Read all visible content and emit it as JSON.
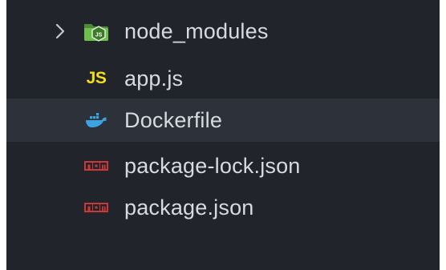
{
  "explorer": {
    "items": [
      {
        "label": "node_modules",
        "icon": "node-folder-icon",
        "expandable": true,
        "expanded": false,
        "selected": false
      },
      {
        "label": "app.js",
        "icon": "javascript-icon",
        "icon_text": "JS",
        "selected": false
      },
      {
        "label": "Dockerfile",
        "icon": "docker-icon",
        "selected": true
      },
      {
        "label": "package-lock.json",
        "icon": "npm-icon",
        "selected": false
      },
      {
        "label": "package.json",
        "icon": "npm-icon",
        "selected": false
      }
    ]
  },
  "colors": {
    "background": "#21252b",
    "selected_row": "#2c313a",
    "text": "#d7dae0",
    "js_yellow": "#f5de19",
    "docker_blue": "#3ca3e0",
    "npm_red": "#cb3837",
    "node_green": "#6dbf4b"
  }
}
